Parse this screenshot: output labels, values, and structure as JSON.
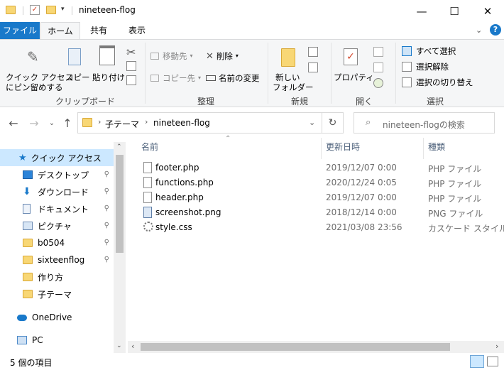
{
  "window": {
    "title": "nineteen-flog",
    "controls": {
      "minimize": "—",
      "maximize": "☐",
      "close": "✕"
    }
  },
  "ribbon": {
    "tabs": [
      {
        "label": "ファイル",
        "active": false
      },
      {
        "label": "ホーム",
        "active": true
      },
      {
        "label": "共有",
        "active": false
      },
      {
        "label": "表示",
        "active": false
      }
    ],
    "help": "?",
    "groups": {
      "clipboard": {
        "label": "クリップボード",
        "quick_access_line1": "クイック アクセス",
        "quick_access_line2": "にピン留めする",
        "copy": "コピー",
        "paste": "貼り付け"
      },
      "organize": {
        "label": "整理",
        "move_to": "移動先",
        "copy_to": "コピー先",
        "delete": "削除",
        "rename": "名前の変更"
      },
      "new": {
        "label": "新規",
        "new_folder_line1": "新しい",
        "new_folder_line2": "フォルダー"
      },
      "open": {
        "label": "開く",
        "properties": "プロパティ"
      },
      "select": {
        "label": "選択",
        "select_all": "すべて選択",
        "select_none": "選択解除",
        "invert": "選択の切り替え"
      }
    }
  },
  "address": {
    "breadcrumb": [
      "子テーマ",
      "nineteen-flog"
    ],
    "search_placeholder": "nineteen-flogの検索"
  },
  "nav": {
    "items": [
      {
        "label": "クイック アクセス",
        "selected": true,
        "pinned": false
      },
      {
        "label": "デスクトップ",
        "pinned": true
      },
      {
        "label": "ダウンロード",
        "pinned": true
      },
      {
        "label": "ドキュメント",
        "pinned": true
      },
      {
        "label": "ピクチャ",
        "pinned": true
      },
      {
        "label": "b0504",
        "pinned": true
      },
      {
        "label": "sixteenflog",
        "pinned": true
      },
      {
        "label": "作り方",
        "pinned": false
      },
      {
        "label": "子テーマ",
        "pinned": false
      },
      {
        "label": "OneDrive",
        "pinned": false
      },
      {
        "label": "PC",
        "pinned": false
      }
    ]
  },
  "files": {
    "columns": {
      "name": "名前",
      "modified": "更新日時",
      "type": "種類"
    },
    "rows": [
      {
        "name": "footer.php",
        "modified": "2019/12/07 0:00",
        "type": "PHP ファイル",
        "icon": "php-file-icon"
      },
      {
        "name": "functions.php",
        "modified": "2020/12/24 0:05",
        "type": "PHP ファイル",
        "icon": "php-file-icon"
      },
      {
        "name": "header.php",
        "modified": "2019/12/07 0:00",
        "type": "PHP ファイル",
        "icon": "php-file-icon"
      },
      {
        "name": "screenshot.png",
        "modified": "2018/12/14 0:00",
        "type": "PNG ファイル",
        "icon": "image-file-icon"
      },
      {
        "name": "style.css",
        "modified": "2021/03/08 23:56",
        "type": "カスケード スタイル シ",
        "icon": "css-file-icon"
      }
    ]
  },
  "status": {
    "item_count": "5 個の項目"
  },
  "colors": {
    "accent": "#1979ca",
    "selection": "#cce8ff",
    "folder": "#f8d775"
  }
}
